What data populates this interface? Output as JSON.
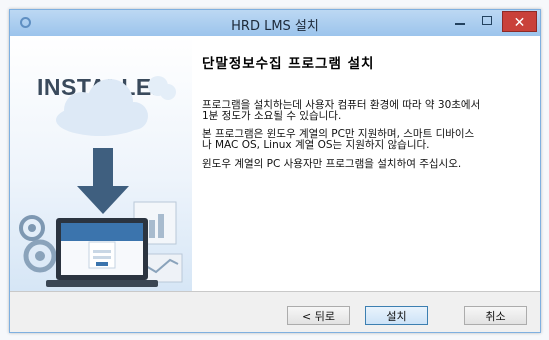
{
  "window": {
    "title": "HRD LMS 설치"
  },
  "sidebar": {
    "brand": "INSTALLER"
  },
  "main": {
    "heading": "단말정보수집 프로그램 설치",
    "para1_line1": "프로그램을 설치하는데 사용자 컴퓨터 환경에 따라 약 30초에서",
    "para1_line2": "1분 정도가 소요될 수 있습니다.",
    "para2_line1": "본 프로그램은 윈도우 계열의 PC만 지원하며, 스마트 디바이스",
    "para2_line2": "나 MAC OS, Linux 계열 OS는 지원하지 않습니다.",
    "para3": "윈도우 계열의 PC 사용자만 프로그램을 설치하여 주십시오."
  },
  "buttons": {
    "back": "< 뒤로",
    "install": "설치",
    "cancel": "취소"
  },
  "colors": {
    "accent": "#3c7fb1",
    "close": "#c9413a",
    "arrow": "#3f5f7f"
  }
}
